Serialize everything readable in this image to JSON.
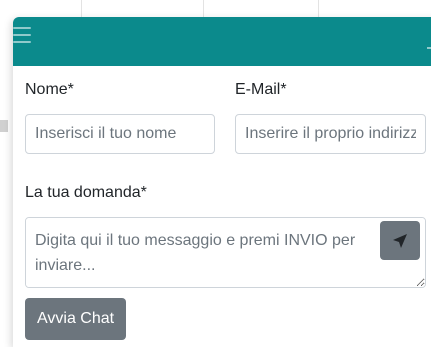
{
  "form": {
    "name_label": "Nome*",
    "name_placeholder": "Inserisci il tuo nome",
    "email_label": "E-Mail*",
    "email_placeholder": "Inserire il proprio indirizzo e-mail",
    "question_label": "La tua domanda*",
    "message_placeholder": "Digita qui il tuo messaggio e premi INVIO per inviare...",
    "start_button": "Avvia Chat"
  },
  "icons": {
    "menu": "hamburger-icon",
    "minimize": "minimize-icon",
    "send": "send-arrow-icon"
  },
  "colors": {
    "header": "#0b8a8c",
    "button": "#6c757d"
  }
}
